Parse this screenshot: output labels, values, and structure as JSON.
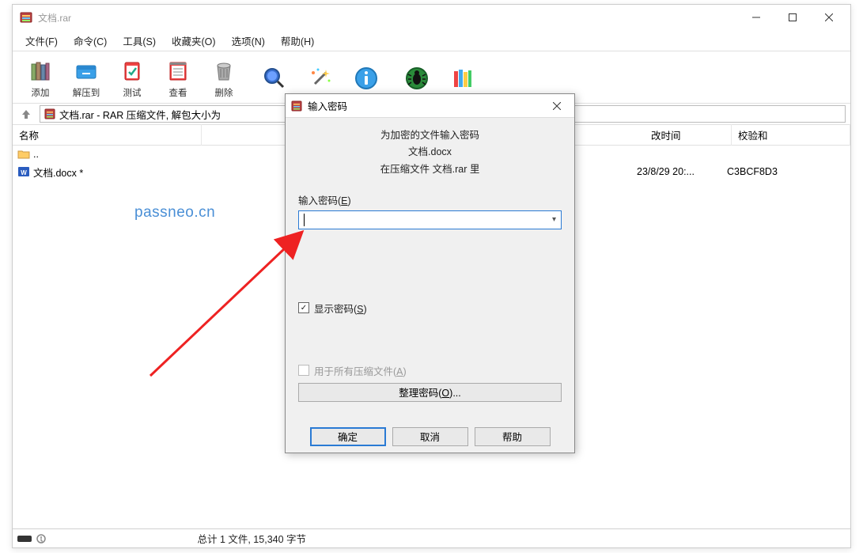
{
  "window": {
    "title": "文档.rar"
  },
  "menu": {
    "file": "文件(F)",
    "command": "命令(C)",
    "tools": "工具(S)",
    "favorites": "收藏夹(O)",
    "options": "选项(N)",
    "help": "帮助(H)"
  },
  "toolbar": {
    "add": "添加",
    "extract": "解压到",
    "test": "测试",
    "view": "查看",
    "delete": "删除"
  },
  "pathbar": {
    "text": "文档.rar - RAR 压缩文件, 解包大小为"
  },
  "columns": {
    "name": "名称",
    "date": "改时间",
    "crc": "校验和"
  },
  "files": {
    "up": "..",
    "row1_name": "文档.docx *",
    "row1_date": "23/8/29 20:...",
    "row1_crc": "C3BCF8D3"
  },
  "statusbar": {
    "text": "总计 1 文件, 15,340 字节"
  },
  "watermark": "passneo.cn",
  "dialog": {
    "title": "输入密码",
    "msg_line1": "为加密的文件输入密码",
    "msg_line2": "文档.docx",
    "msg_line3": "在压缩文件 文档.rar 里",
    "input_label_prefix": "输入密码(",
    "input_label_key": "E",
    "input_label_suffix": ")",
    "show_pwd_prefix": "显示密码(",
    "show_pwd_key": "S",
    "show_pwd_suffix": ")",
    "use_all_prefix": "用于所有压缩文件(",
    "use_all_key": "A",
    "use_all_suffix": ")",
    "organize_prefix": "整理密码(",
    "organize_key": "O",
    "organize_suffix": ")...",
    "ok": "确定",
    "cancel": "取消",
    "help": "帮助"
  }
}
